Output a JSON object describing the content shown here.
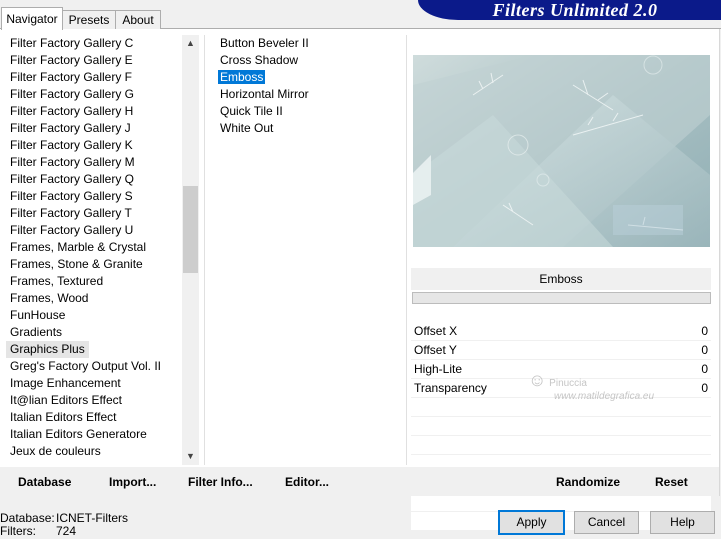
{
  "banner": {
    "title": "Filters Unlimited 2.0"
  },
  "tabs": [
    {
      "label": "Navigator",
      "active": true
    },
    {
      "label": "Presets",
      "active": false
    },
    {
      "label": "About",
      "active": false
    }
  ],
  "categories": {
    "items": [
      "Filter Factory Gallery C",
      "Filter Factory Gallery E",
      "Filter Factory Gallery F",
      "Filter Factory Gallery G",
      "Filter Factory Gallery H",
      "Filter Factory Gallery J",
      "Filter Factory Gallery K",
      "Filter Factory Gallery M",
      "Filter Factory Gallery Q",
      "Filter Factory Gallery S",
      "Filter Factory Gallery T",
      "Filter Factory Gallery U",
      "Frames, Marble & Crystal",
      "Frames, Stone & Granite",
      "Frames, Textured",
      "Frames, Wood",
      "FunHouse",
      "Gradients",
      "Graphics Plus",
      "Greg's Factory Output Vol. II",
      "Image Enhancement",
      "It@lian Editors Effect",
      "Italian Editors Effect",
      "Italian Editors Generatore",
      "Jeux de couleurs"
    ],
    "selected": "Graphics Plus"
  },
  "filters": {
    "items": [
      "Button Beveler II",
      "Cross Shadow",
      "Emboss",
      "Horizontal Mirror",
      "Quick Tile II",
      "White Out"
    ],
    "selected": "Emboss"
  },
  "current_filter": "Emboss",
  "progress": 0,
  "params": [
    {
      "name": "Offset X",
      "value": "0"
    },
    {
      "name": "Offset Y",
      "value": "0"
    },
    {
      "name": "High-Lite",
      "value": "0"
    },
    {
      "name": "Transparency",
      "value": "0"
    }
  ],
  "watermark": {
    "line1": "Pinuccia",
    "line2": "www.matildegrafica.eu"
  },
  "bottom_buttons": {
    "database": "Database",
    "import": "Import...",
    "filter_info": "Filter Info...",
    "editor": "Editor...",
    "randomize": "Randomize",
    "reset": "Reset"
  },
  "status": {
    "database_label": "Database:",
    "database_value": "ICNET-Filters",
    "filters_label": "Filters:",
    "filters_value": "724"
  },
  "dialog_buttons": {
    "apply": "Apply",
    "cancel": "Cancel",
    "help": "Help"
  }
}
